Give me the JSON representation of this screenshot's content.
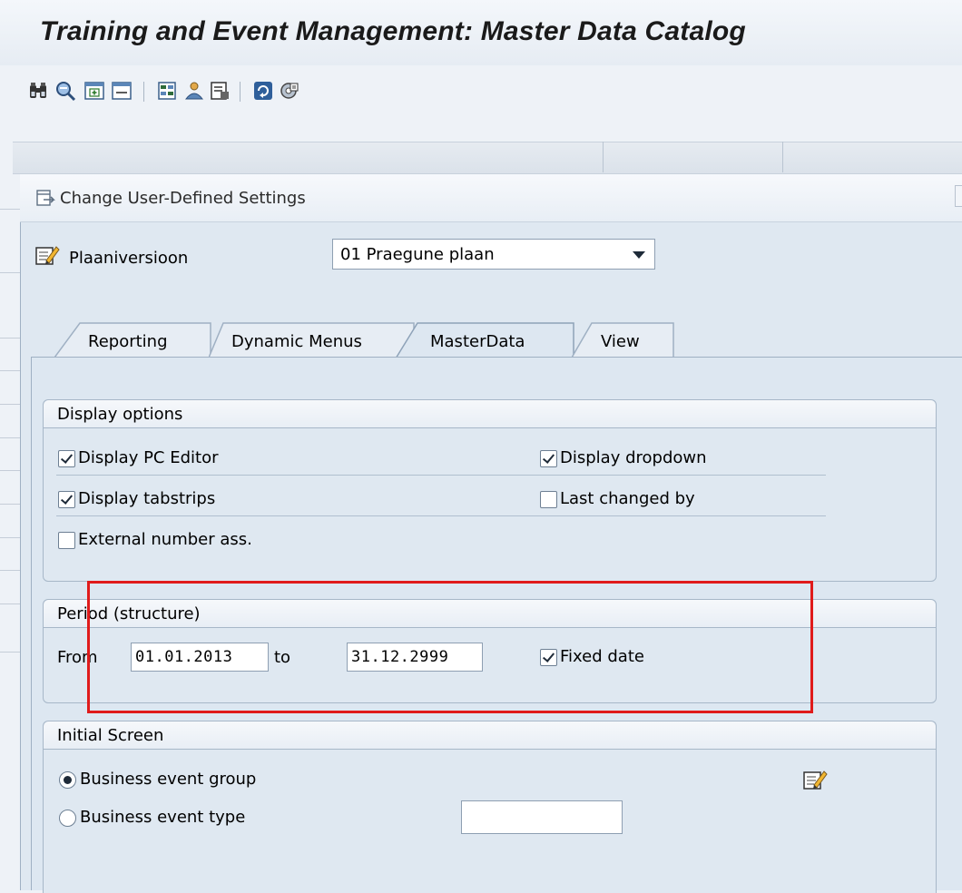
{
  "window": {
    "title": "Training and Event Management: Master Data Catalog"
  },
  "toolbar": {
    "icons": [
      "find-icon",
      "find-next-icon",
      "expand-icon",
      "collapse-icon",
      "structure-icon",
      "person-icon",
      "details-icon",
      "refresh-icon",
      "settings-icon"
    ]
  },
  "dialog": {
    "title": "Change User-Defined Settings",
    "plan_version": {
      "label": "Plaaniversioon",
      "value": "01 Praegune plaan"
    },
    "tabs": [
      {
        "label": "Reporting",
        "active": false
      },
      {
        "label": "Dynamic Menus",
        "active": false
      },
      {
        "label": "MasterData",
        "active": true
      },
      {
        "label": "View",
        "active": false
      }
    ]
  },
  "display_options": {
    "title": "Display options",
    "pc_editor": {
      "label": "Display PC Editor",
      "checked": true
    },
    "dropdown": {
      "label": "Display dropdown",
      "checked": true
    },
    "tabstrips": {
      "label": "Display tabstrips",
      "checked": true
    },
    "last_changed": {
      "label": "Last changed by",
      "checked": false
    },
    "external_number": {
      "label": "External number ass.",
      "checked": false
    }
  },
  "period": {
    "title": "Period (structure)",
    "from_label": "From",
    "from_value": "01.01.2013",
    "to_label": "to",
    "to_value": "31.12.2999",
    "fixed_date": {
      "label": "Fixed date",
      "checked": true
    }
  },
  "initial_screen": {
    "title": "Initial Screen",
    "option_group": {
      "label": "Business event group",
      "selected": true
    },
    "option_type": {
      "label": "Business event type",
      "selected": false
    },
    "type_value": ""
  },
  "colors": {
    "highlight": "#e01b1b",
    "panel": "#dfe8f1"
  }
}
